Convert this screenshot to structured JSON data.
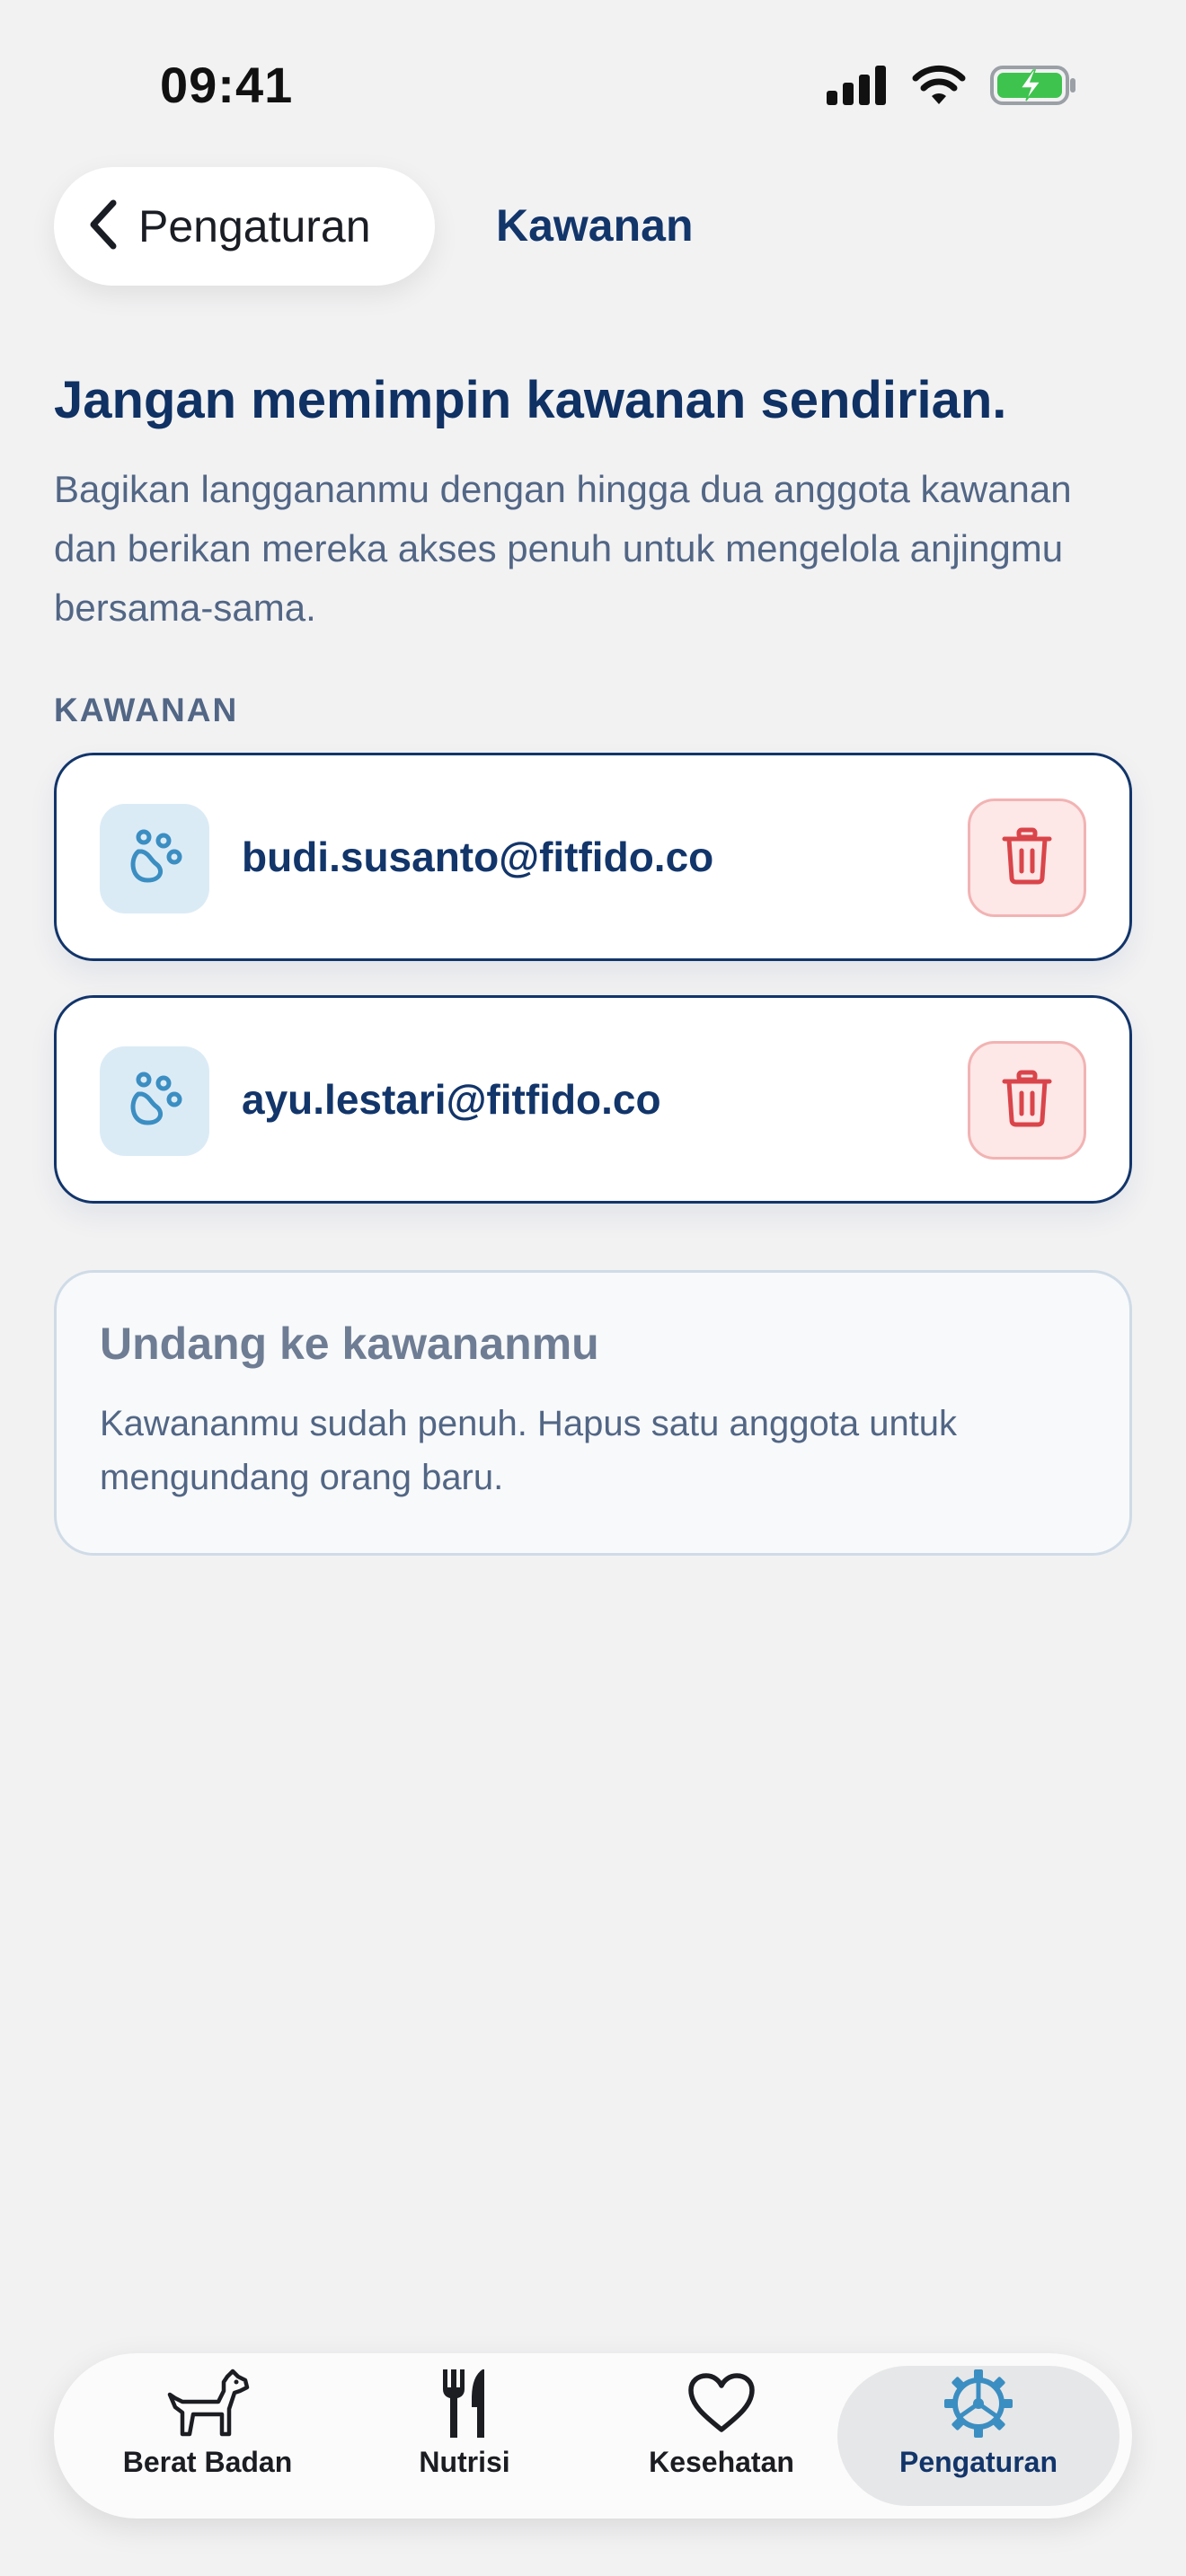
{
  "status_bar": {
    "time": "09:41"
  },
  "header": {
    "back_label": "Pengaturan",
    "title": "Kawanan"
  },
  "intro": {
    "headline": "Jangan memimpin kawanan sendirian.",
    "description": "Bagikan langgananmu dengan hingga dua anggota kawanan dan berikan mereka akses penuh untuk mengelola anjingmu bersama-sama."
  },
  "members_section": {
    "label": "KAWANAN",
    "members": [
      {
        "email": "budi.susanto@fitfido.co"
      },
      {
        "email": "ayu.lestari@fitfido.co"
      }
    ]
  },
  "invite": {
    "title": "Undang ke kawananmu",
    "description": "Kawananmu sudah penuh. Hapus satu anggota untuk mengundang orang baru."
  },
  "tab_bar": {
    "tabs": [
      {
        "label": "Berat Badan",
        "icon": "dog-icon"
      },
      {
        "label": "Nutrisi",
        "icon": "fork-knife-icon"
      },
      {
        "label": "Kesehatan",
        "icon": "heart-icon"
      },
      {
        "label": "Pengaturan",
        "icon": "gear-icon"
      }
    ],
    "active_index": 3
  },
  "colors": {
    "primary": "#12356a",
    "muted_text": "#526685",
    "accent_blue": "#3b8ec2",
    "danger": "#d9454a",
    "danger_bg": "#fde7e7",
    "background": "#f2f2f3"
  }
}
